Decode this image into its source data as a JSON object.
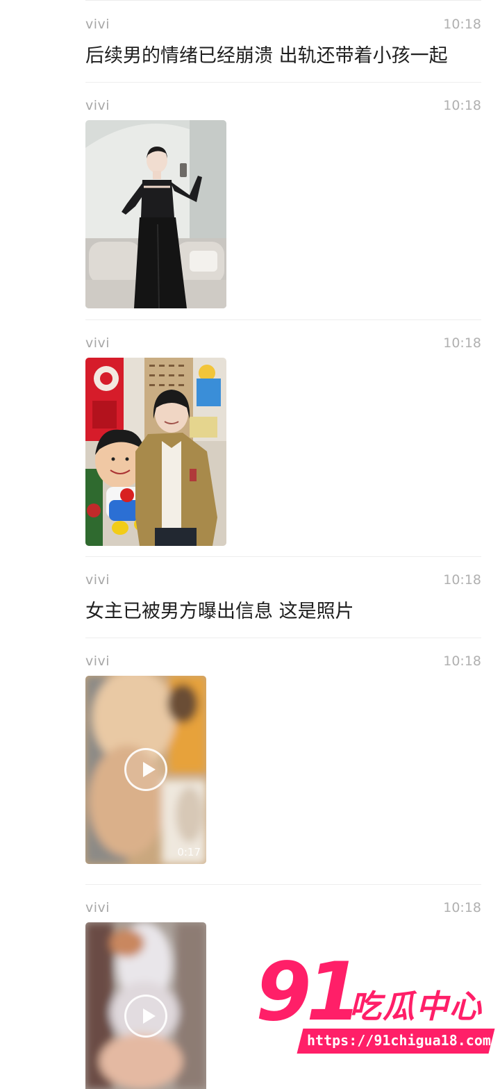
{
  "messages": [
    {
      "sender": "vivi",
      "time": "10:18",
      "text": "后续男的情绪已经崩溃 出轨还带着小孩一起"
    },
    {
      "sender": "vivi",
      "time": "10:18",
      "image": "photo-woman-black-outfit"
    },
    {
      "sender": "vivi",
      "time": "10:18",
      "image": "photo-woman-with-toy"
    },
    {
      "sender": "vivi",
      "time": "10:18",
      "text": "女主已被男方曝出信息 这是照片"
    },
    {
      "sender": "vivi",
      "time": "10:18",
      "video": {
        "duration": "0:17"
      }
    },
    {
      "sender": "vivi",
      "time": "10:18",
      "video": {
        "duration": ""
      }
    }
  ],
  "watermark": {
    "logo_number": "91",
    "logo_text": "吃瓜中心",
    "url": "https://91chigua18.com"
  },
  "colors": {
    "watermark_pink": "#ff1f68",
    "meta_gray": "#a7a7a7"
  }
}
